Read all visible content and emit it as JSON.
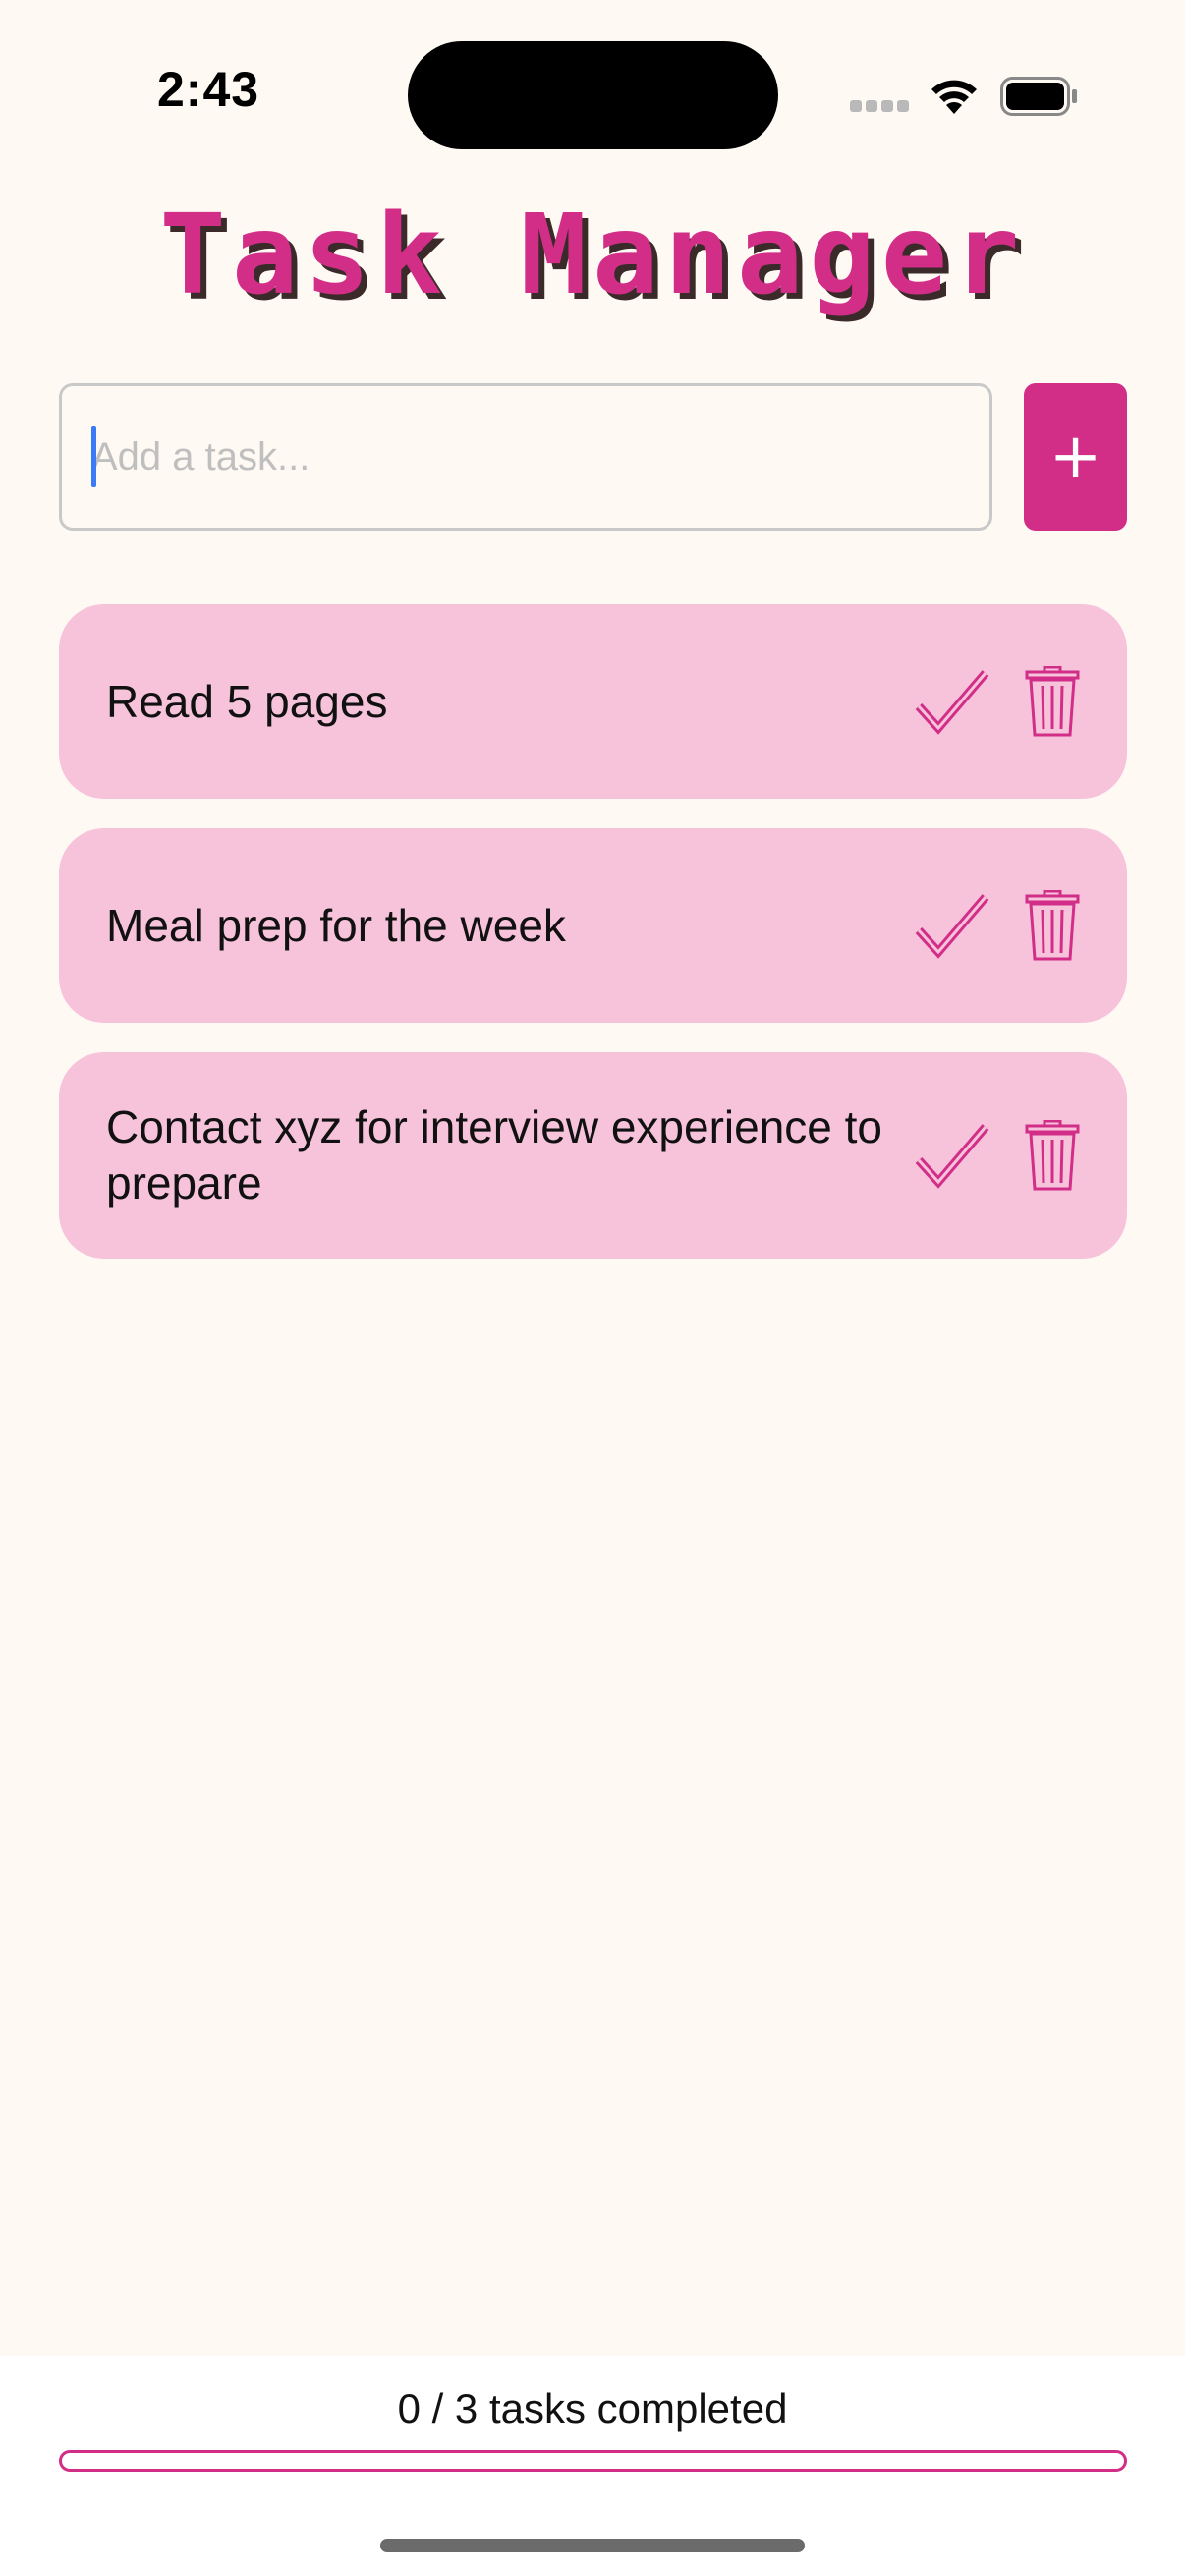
{
  "status_bar": {
    "time": "2:43"
  },
  "header": {
    "title": "Task Manager"
  },
  "input": {
    "value": "",
    "placeholder": "Add a task..."
  },
  "add_button": {
    "label": "+"
  },
  "tasks": [
    {
      "text": "Read 5 pages",
      "completed": false
    },
    {
      "text": "Meal prep for the week",
      "completed": false
    },
    {
      "text": "Contact xyz for interview experience to prepare",
      "completed": false
    }
  ],
  "footer": {
    "progress_text": "0 / 3 tasks completed",
    "completed": 0,
    "total": 3
  },
  "colors": {
    "accent": "#D22E88",
    "card": "#F7C3DB",
    "background": "#FFF9F3"
  },
  "icons": {
    "complete": "check-icon",
    "delete": "trash-icon",
    "wifi": "wifi-icon",
    "battery": "battery-icon",
    "cellular": "cellular-signal-icon"
  }
}
